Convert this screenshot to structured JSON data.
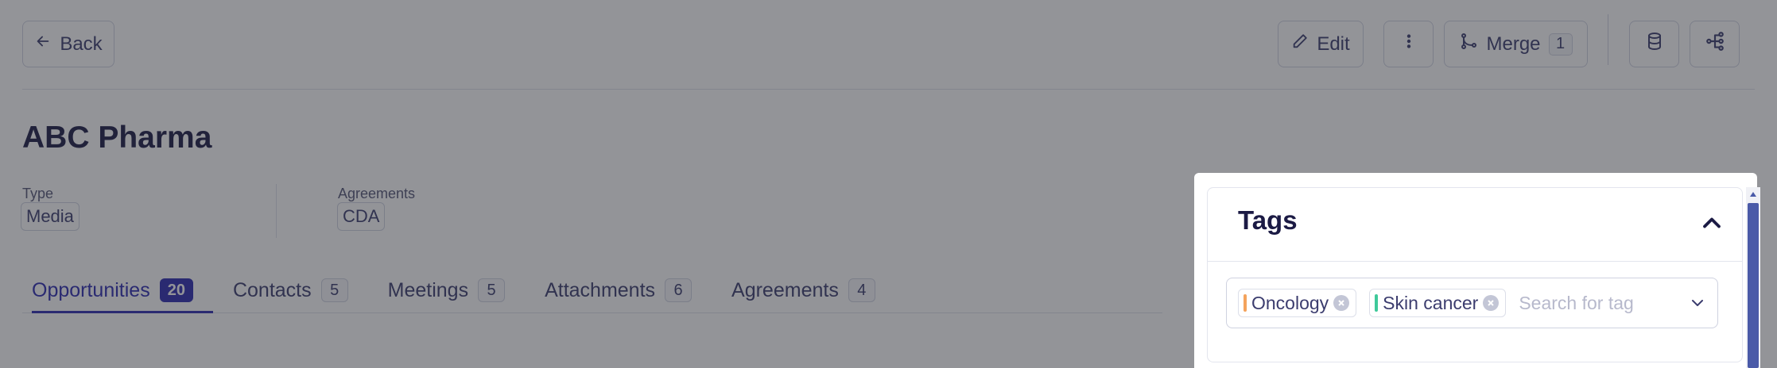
{
  "toolbar": {
    "back_label": "Back",
    "edit_label": "Edit",
    "merge_label": "Merge",
    "merge_count": "1"
  },
  "record": {
    "title": "ABC Pharma",
    "fields": [
      {
        "label": "Type",
        "value": "Media"
      },
      {
        "label": "Agreements",
        "value": "CDA"
      }
    ]
  },
  "tabs": [
    {
      "label": "Opportunities",
      "count": "20",
      "active": true
    },
    {
      "label": "Contacts",
      "count": "5"
    },
    {
      "label": "Meetings",
      "count": "5"
    },
    {
      "label": "Attachments",
      "count": "6"
    },
    {
      "label": "Agreements",
      "count": "4"
    }
  ],
  "tags_panel": {
    "title": "Tags",
    "tags": [
      {
        "label": "Oncology",
        "color": "#f4a35c"
      },
      {
        "label": "Skin cancer",
        "color": "#3fc99a"
      }
    ],
    "search_placeholder": "Search for tag"
  },
  "colors": {
    "accent": "#2c2bb0",
    "overlay": "rgba(40,41,50,0.5)"
  }
}
